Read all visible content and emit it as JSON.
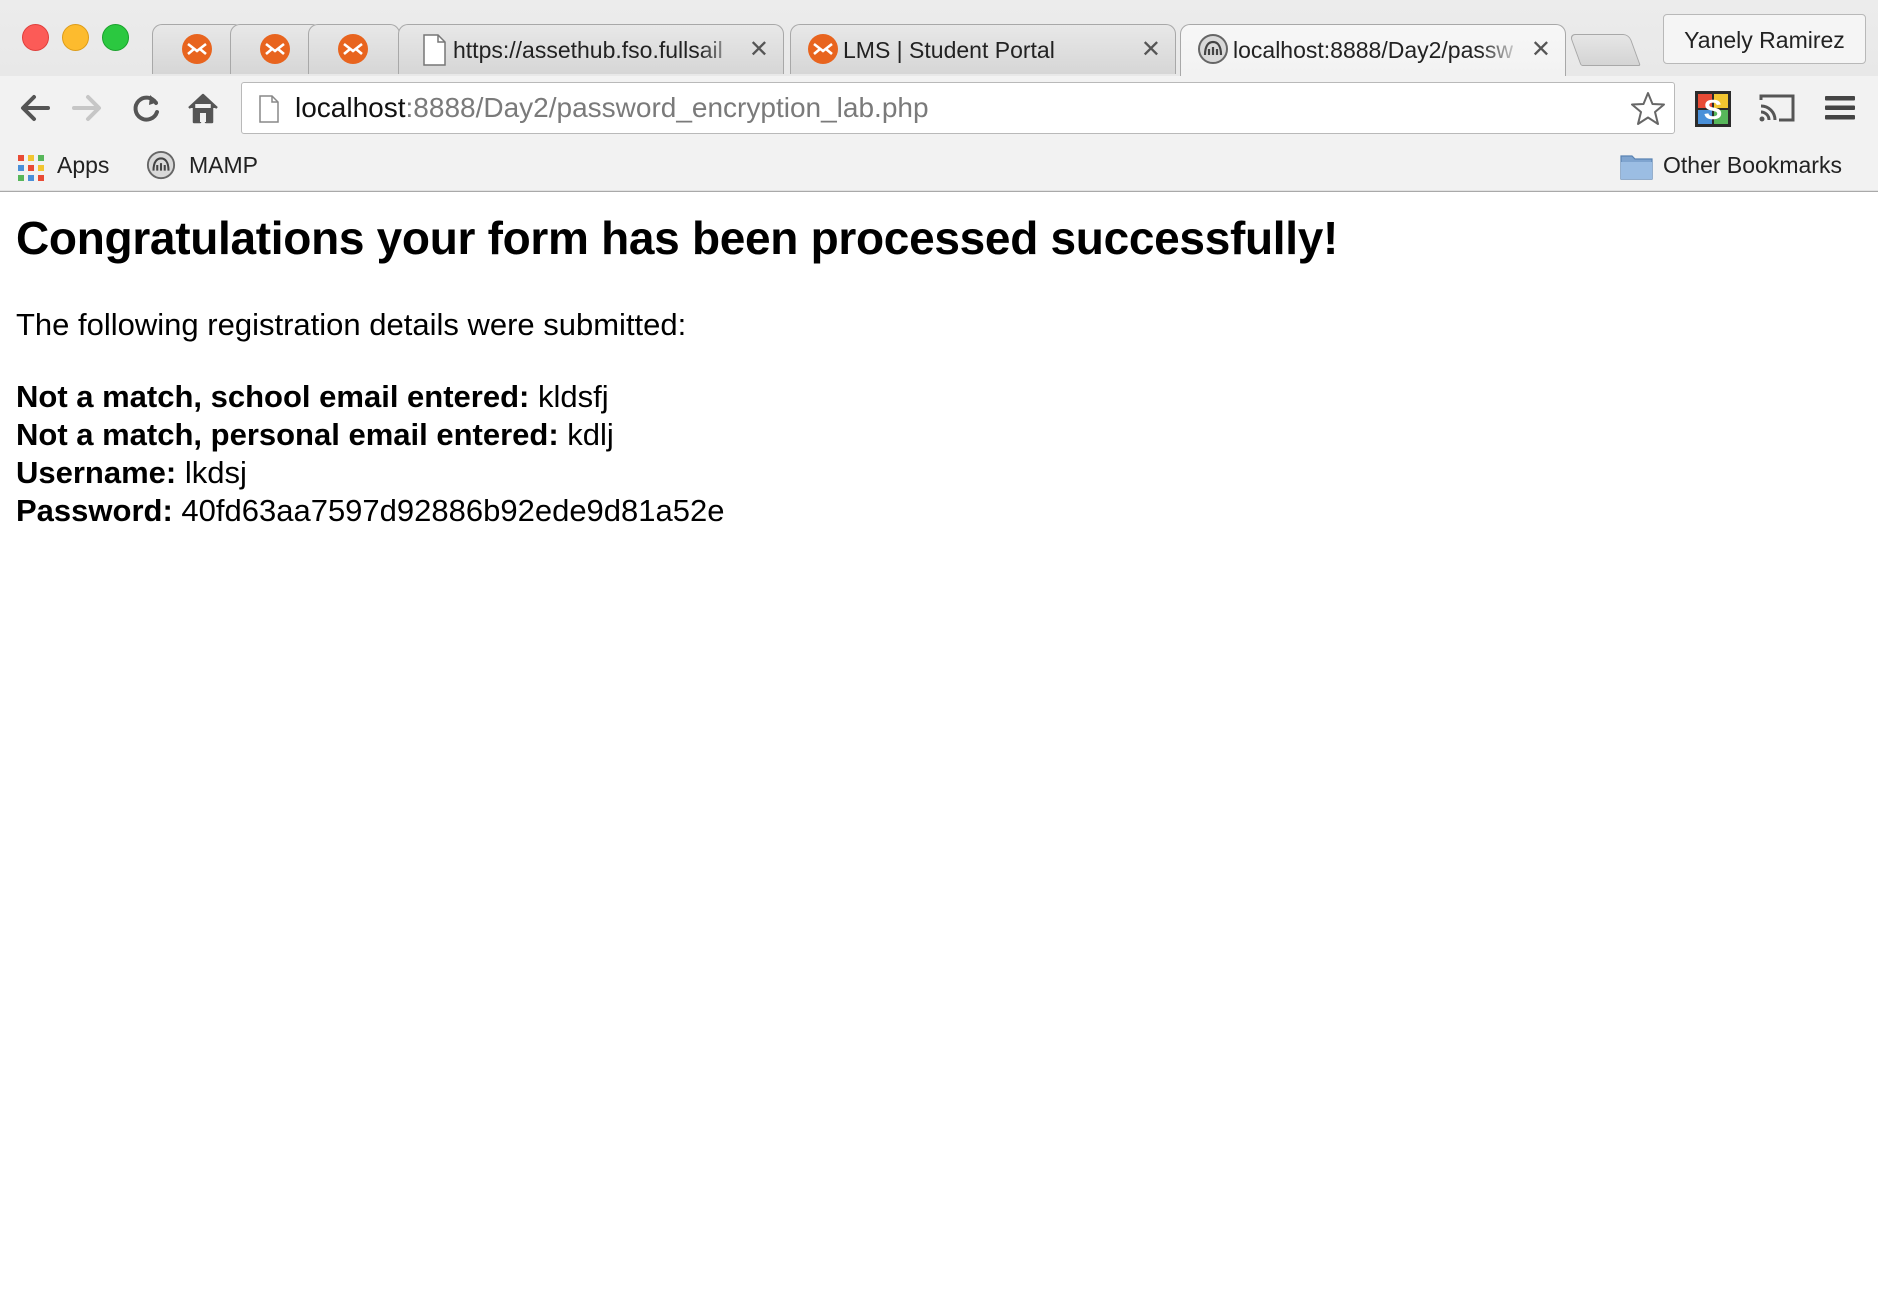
{
  "window": {
    "profile_name": "Yanely Ramirez"
  },
  "tabs": [
    {
      "title": "",
      "icon": "fullsail-icon",
      "active": false
    },
    {
      "title": "",
      "icon": "fullsail-icon",
      "active": false
    },
    {
      "title": "",
      "icon": "fullsail-icon",
      "active": false
    },
    {
      "title": "https://assethub.fso.fullsail",
      "icon": "page-icon",
      "active": false
    },
    {
      "title": "LMS | Student Portal",
      "icon": "fullsail-icon",
      "active": false
    },
    {
      "title": "localhost:8888/Day2/passw",
      "icon": "mamp-icon",
      "active": true
    }
  ],
  "toolbar": {
    "url_host": "localhost",
    "url_rest": ":8888/Day2/password_encryption_lab.php"
  },
  "bookmarks": {
    "apps_label": "Apps",
    "mamp_label": "MAMP",
    "other_label": "Other Bookmarks"
  },
  "page": {
    "heading": "Congratulations your form has been processed successfully!",
    "intro": "The following registration details were submitted:",
    "details": [
      {
        "label": "Not a match, school email entered:",
        "value": "kldsfj"
      },
      {
        "label": "Not a match, personal email entered:",
        "value": "kdlj"
      },
      {
        "label": "Username:",
        "value": "lkdsj"
      },
      {
        "label": "Password:",
        "value": "40fd63aa7597d92886b92ede9d81a52e"
      }
    ]
  },
  "colors": {
    "fullsail_orange": "#e8641e",
    "close_red": "#fc5b57",
    "minimize_yellow": "#fdbb2e",
    "zoom_green": "#2bc840"
  }
}
